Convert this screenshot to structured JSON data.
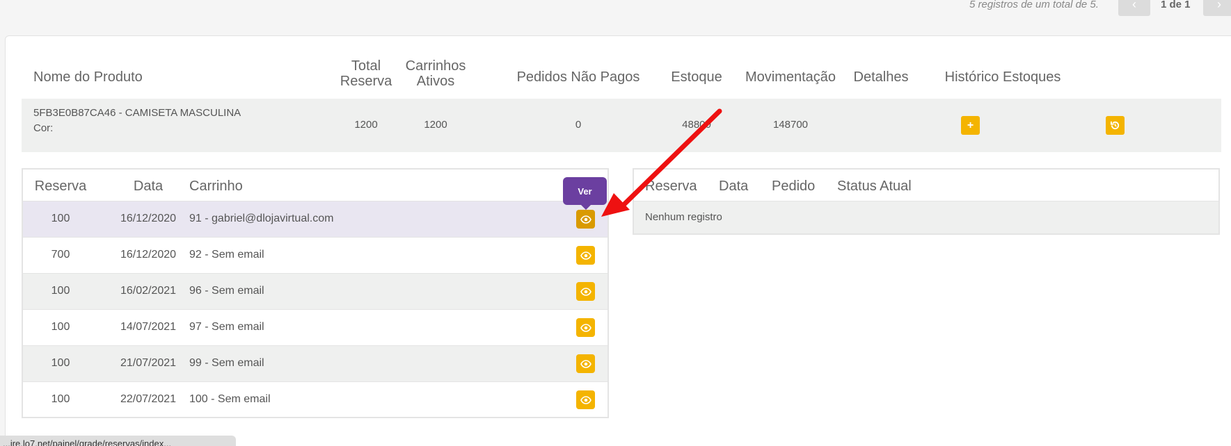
{
  "pager": {
    "info": "5 registros de um total de 5.",
    "prev_icon": "chevron-left-icon",
    "page": "1 de 1",
    "next_icon": "chevron-right-icon"
  },
  "product_table": {
    "headers": {
      "name": "Nome do Produto",
      "total_reserva": "Total\nReserva",
      "carrinhos": "Carrinhos\nAtivos",
      "pedidos": "Pedidos Não Pagos",
      "estoque": "Estoque",
      "movimentacao": "Movimentação",
      "detalhes": "Detalhes",
      "historico": "Histórico Estoques"
    },
    "row": {
      "name": "5FB3E0B87CA46 - CAMISETA MASCULINA",
      "cor": "Cor:",
      "total_reserva": "1200",
      "carrinhos": "1200",
      "pedidos": "0",
      "estoque": "48800",
      "movimentacao": "148700",
      "detalhes_icon": "plus-icon",
      "historico_icon": "history-icon"
    }
  },
  "reservas_table": {
    "headers": {
      "reserva": "Reserva",
      "data": "Data",
      "carrinho": "Carrinho"
    },
    "rows": [
      {
        "reserva": "100",
        "data": "16/12/2020",
        "carrinho": "91 - gabriel@dlojavirtual.com"
      },
      {
        "reserva": "700",
        "data": "16/12/2020",
        "carrinho": "92 - Sem email"
      },
      {
        "reserva": "100",
        "data": "16/02/2021",
        "carrinho": "96 - Sem email"
      },
      {
        "reserva": "100",
        "data": "14/07/2021",
        "carrinho": "97 - Sem email"
      },
      {
        "reserva": "100",
        "data": "21/07/2021",
        "carrinho": "99 - Sem email"
      },
      {
        "reserva": "100",
        "data": "22/07/2021",
        "carrinho": "100 - Sem email"
      }
    ],
    "tooltip": "Ver",
    "view_icon": "eye-icon"
  },
  "pedidos_table": {
    "headers": {
      "reserva": "Reserva",
      "data": "Data",
      "pedido": "Pedido",
      "status": "Status Atual"
    },
    "empty": "Nenhum registro"
  },
  "status_bar": {
    "url": "...ire.lo7.net/painel/grade/reservas/index..."
  },
  "colors": {
    "accent": "#f4b400",
    "tooltip": "#6b3fa0",
    "arrow": "#ee1111"
  }
}
